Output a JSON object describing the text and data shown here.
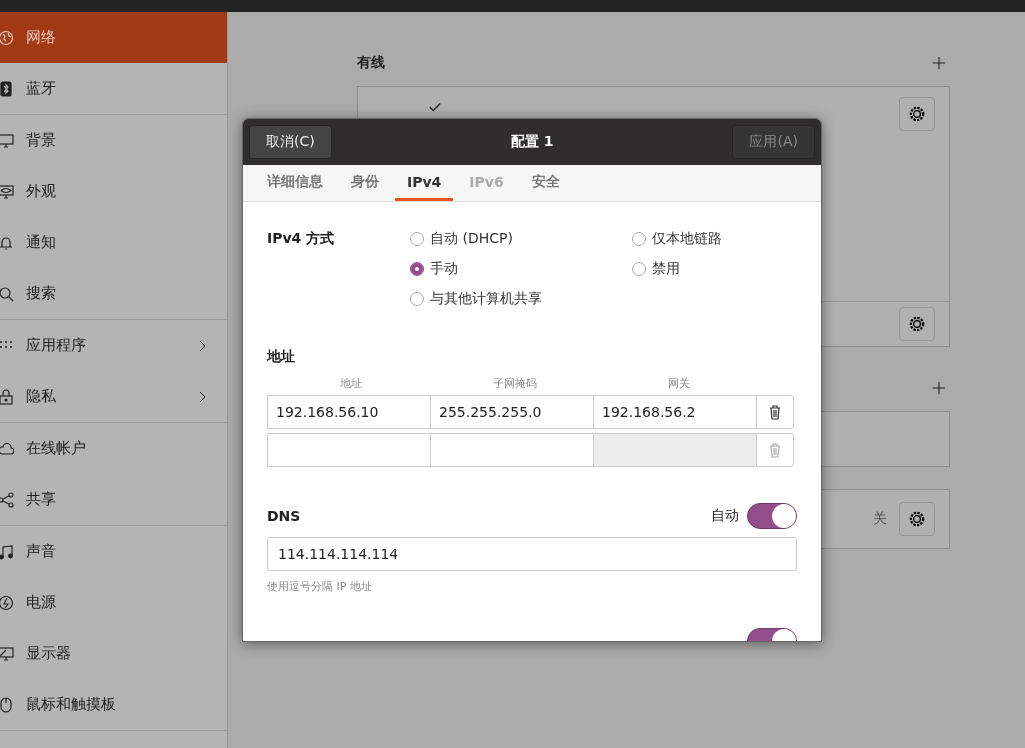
{
  "sidebar": {
    "groups": [
      {
        "items": [
          {
            "label": "网络",
            "selected": true
          },
          {
            "label": "蓝牙",
            "selected": false
          }
        ]
      },
      {
        "items": [
          {
            "label": "背景",
            "selected": false
          },
          {
            "label": "外观",
            "selected": false
          },
          {
            "label": "通知",
            "selected": false
          },
          {
            "label": "搜索",
            "selected": false
          }
        ]
      },
      {
        "items": [
          {
            "label": "应用程序",
            "selected": false,
            "submenu": true
          },
          {
            "label": "隐私",
            "selected": false,
            "submenu": true
          }
        ]
      },
      {
        "items": [
          {
            "label": "在线帐户",
            "selected": false
          },
          {
            "label": "共享",
            "selected": false
          }
        ]
      },
      {
        "items": [
          {
            "label": "声音",
            "selected": false
          },
          {
            "label": "电源",
            "selected": false
          },
          {
            "label": "显示器",
            "selected": false
          },
          {
            "label": "鼠标和触摸板",
            "selected": false
          }
        ]
      }
    ]
  },
  "main": {
    "wired": {
      "title": "有线",
      "profile": {
        "active": true
      }
    },
    "third_card": {
      "status": "关"
    }
  },
  "dialog": {
    "title": "配置 1",
    "cancel": "取消(C)",
    "apply": {
      "label": "应用(A)",
      "disabled": true
    },
    "tabs": [
      {
        "label": "详细信息",
        "selected": false,
        "disabled": false
      },
      {
        "label": "身份",
        "selected": false,
        "disabled": false
      },
      {
        "label": "IPv4",
        "selected": true,
        "disabled": false
      },
      {
        "label": "IPv6",
        "selected": false,
        "disabled": true
      },
      {
        "label": "安全",
        "selected": false,
        "disabled": false
      }
    ],
    "method": {
      "label": "IPv4 方式",
      "options": [
        {
          "label": "自动 (DHCP)",
          "selected": false
        },
        {
          "label": "仅本地链路",
          "selected": false
        },
        {
          "label": "手动",
          "selected": true
        },
        {
          "label": "禁用",
          "selected": false
        },
        {
          "label": "与其他计算机共享",
          "selected": false
        }
      ]
    },
    "addresses": {
      "title": "地址",
      "columns": [
        "地址",
        "子网掩码",
        "网关"
      ],
      "rows": [
        {
          "address": "192.168.56.10",
          "netmask": "255.255.255.0",
          "gateway": "192.168.56.2",
          "removable": true,
          "gateway_disabled": false
        },
        {
          "removable": false,
          "gateway_disabled": true
        }
      ]
    },
    "dns": {
      "title": "DNS",
      "auto_label": "自动",
      "auto": true,
      "value": "114.114.114.114",
      "hint": "使用逗号分隔 IP 地址"
    },
    "routes": {
      "auto": true
    }
  }
}
